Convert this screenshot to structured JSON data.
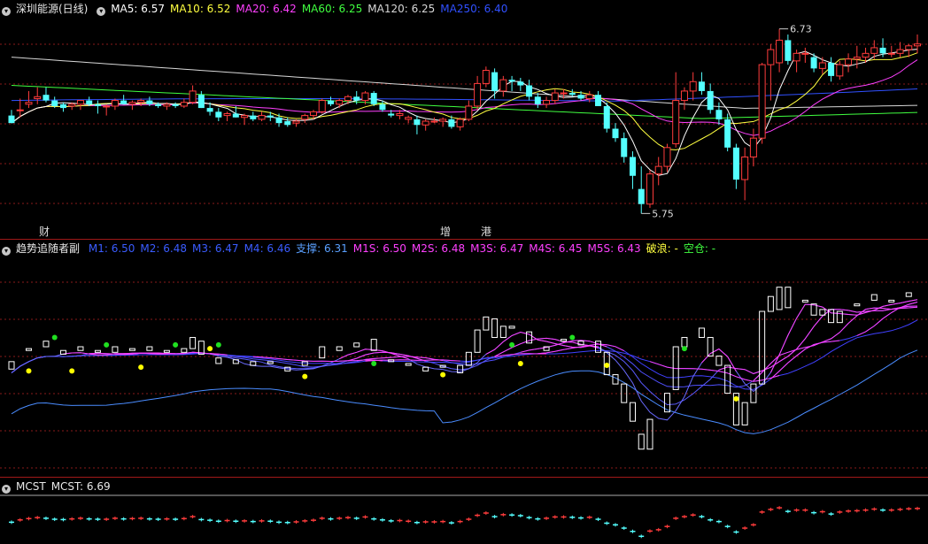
{
  "pane1": {
    "title": "深圳能源(日线)",
    "ma": [
      {
        "label": "MA5: 6.57",
        "color": "#ffffff"
      },
      {
        "label": "MA10: 6.52",
        "color": "#ffff40"
      },
      {
        "label": "MA20: 6.42",
        "color": "#ff40ff"
      },
      {
        "label": "MA60: 6.25",
        "color": "#40ff40"
      },
      {
        "label": "MA120: 6.25",
        "color": "#d8d8d8"
      },
      {
        "label": "MA250: 6.40",
        "color": "#3050ff"
      }
    ],
    "high_label": "6.73",
    "low_label": "5.75",
    "markers": [
      {
        "text": "财",
        "color": "#6aa8ff"
      },
      {
        "text": "增",
        "color": "#ff5050"
      },
      {
        "text": "港",
        "color": "#40e040"
      }
    ]
  },
  "pane2": {
    "title": "趋势追随者副",
    "fields": [
      {
        "label": "M1: 6.50",
        "color": "#3a5cff"
      },
      {
        "label": "M2: 6.48",
        "color": "#3a5cff"
      },
      {
        "label": "M3: 6.47",
        "color": "#3a5cff"
      },
      {
        "label": "M4: 6.46",
        "color": "#3a5cff"
      },
      {
        "label": "支撑: 6.31",
        "color": "#5aa0ff"
      },
      {
        "label": "M1S: 6.50",
        "color": "#ff40ff"
      },
      {
        "label": "M2S: 6.48",
        "color": "#ff40ff"
      },
      {
        "label": "M3S: 6.47",
        "color": "#ff40ff"
      },
      {
        "label": "M4S: 6.45",
        "color": "#ff40ff"
      },
      {
        "label": "M5S: 6.43",
        "color": "#ff40ff"
      },
      {
        "label": "破浪: -",
        "color": "#ffff40"
      },
      {
        "label": "空仓: -",
        "color": "#40ff40"
      }
    ]
  },
  "pane3": {
    "title": "MCST",
    "value_label": "MCST: 6.69"
  },
  "colors": {
    "up": "#ff3c3c",
    "down": "#54ffff",
    "grid": "#8a1a1a"
  },
  "chart_data": {
    "type": "candlestick",
    "candles": [
      [
        6.27,
        6.3,
        6.23,
        6.23
      ],
      [
        6.3,
        6.36,
        6.26,
        6.3
      ],
      [
        6.33,
        6.4,
        6.31,
        6.34
      ],
      [
        6.36,
        6.42,
        6.33,
        6.37
      ],
      [
        6.38,
        6.42,
        6.34,
        6.35
      ],
      [
        6.35,
        6.37,
        6.31,
        6.32
      ],
      [
        6.33,
        6.34,
        6.29,
        6.31
      ],
      [
        6.32,
        6.34,
        6.3,
        6.33
      ],
      [
        6.33,
        6.35,
        6.3,
        6.35
      ],
      [
        6.35,
        6.37,
        6.32,
        6.33
      ],
      [
        6.33,
        6.35,
        6.28,
        6.32
      ],
      [
        6.32,
        6.33,
        6.27,
        6.32
      ],
      [
        6.32,
        6.36,
        6.3,
        6.35
      ],
      [
        6.35,
        6.38,
        6.33,
        6.33
      ],
      [
        6.33,
        6.35,
        6.3,
        6.34
      ],
      [
        6.34,
        6.36,
        6.32,
        6.35
      ],
      [
        6.35,
        6.37,
        6.32,
        6.33
      ],
      [
        6.33,
        6.34,
        6.31,
        6.32
      ],
      [
        6.32,
        6.34,
        6.3,
        6.33
      ],
      [
        6.33,
        6.34,
        6.31,
        6.32
      ],
      [
        6.32,
        6.36,
        6.31,
        6.34
      ],
      [
        6.34,
        6.43,
        6.33,
        6.4
      ],
      [
        6.38,
        6.4,
        6.31,
        6.31
      ],
      [
        6.31,
        6.34,
        6.27,
        6.29
      ],
      [
        6.29,
        6.31,
        6.24,
        6.26
      ],
      [
        6.27,
        6.29,
        6.24,
        6.28
      ],
      [
        6.28,
        6.32,
        6.26,
        6.26
      ],
      [
        6.26,
        6.28,
        6.22,
        6.27
      ],
      [
        6.27,
        6.29,
        6.24,
        6.25
      ],
      [
        6.25,
        6.29,
        6.24,
        6.27
      ],
      [
        6.27,
        6.29,
        6.24,
        6.26
      ],
      [
        6.26,
        6.28,
        6.21,
        6.23
      ],
      [
        6.24,
        6.26,
        6.21,
        6.22
      ],
      [
        6.23,
        6.25,
        6.21,
        6.24
      ],
      [
        6.25,
        6.28,
        6.23,
        6.27
      ],
      [
        6.27,
        6.3,
        6.25,
        6.29
      ],
      [
        6.29,
        6.36,
        6.28,
        6.35
      ],
      [
        6.35,
        6.37,
        6.32,
        6.33
      ],
      [
        6.33,
        6.36,
        6.31,
        6.35
      ],
      [
        6.35,
        6.38,
        6.33,
        6.37
      ],
      [
        6.37,
        6.4,
        6.33,
        6.35
      ],
      [
        6.35,
        6.4,
        6.33,
        6.39
      ],
      [
        6.39,
        6.4,
        6.32,
        6.33
      ],
      [
        6.33,
        6.35,
        6.29,
        6.3
      ],
      [
        6.28,
        6.3,
        6.26,
        6.27
      ],
      [
        6.27,
        6.3,
        6.25,
        6.28
      ],
      [
        6.25,
        6.27,
        6.23,
        6.26
      ],
      [
        6.25,
        6.27,
        6.17,
        6.22
      ],
      [
        6.22,
        6.25,
        6.19,
        6.24
      ],
      [
        6.24,
        6.26,
        6.23,
        6.24
      ],
      [
        6.24,
        6.26,
        6.21,
        6.25
      ],
      [
        6.25,
        6.27,
        6.2,
        6.21
      ],
      [
        6.21,
        6.26,
        6.19,
        6.25
      ],
      [
        6.25,
        6.35,
        6.24,
        6.32
      ],
      [
        6.32,
        6.48,
        6.3,
        6.44
      ],
      [
        6.44,
        6.53,
        6.42,
        6.51
      ],
      [
        6.5,
        6.52,
        6.36,
        6.4
      ],
      [
        6.4,
        6.48,
        6.37,
        6.46
      ],
      [
        6.46,
        6.48,
        6.4,
        6.45
      ],
      [
        6.45,
        6.47,
        6.4,
        6.43
      ],
      [
        6.43,
        6.46,
        6.35,
        6.37
      ],
      [
        6.37,
        6.39,
        6.31,
        6.33
      ],
      [
        6.33,
        6.37,
        6.31,
        6.35
      ],
      [
        6.35,
        6.41,
        6.33,
        6.39
      ],
      [
        6.39,
        6.41,
        6.36,
        6.39
      ],
      [
        6.39,
        6.41,
        6.37,
        6.38
      ],
      [
        6.38,
        6.4,
        6.35,
        6.36
      ],
      [
        6.36,
        6.4,
        6.34,
        6.38
      ],
      [
        6.38,
        6.4,
        6.32,
        6.32
      ],
      [
        6.32,
        6.34,
        6.18,
        6.2
      ],
      [
        6.2,
        6.23,
        6.13,
        6.15
      ],
      [
        6.15,
        6.18,
        6.02,
        6.05
      ],
      [
        6.05,
        6.08,
        5.88,
        5.95
      ],
      [
        5.88,
        6.0,
        5.75,
        5.8
      ],
      [
        5.8,
        5.98,
        5.78,
        5.96
      ],
      [
        5.96,
        6.05,
        5.9,
        6.0
      ],
      [
        6.0,
        6.12,
        5.97,
        6.1
      ],
      [
        6.12,
        6.5,
        6.1,
        6.35
      ],
      [
        6.35,
        6.42,
        6.3,
        6.4
      ],
      [
        6.4,
        6.5,
        6.35,
        6.45
      ],
      [
        6.45,
        6.5,
        6.38,
        6.4
      ],
      [
        6.4,
        6.44,
        6.28,
        6.3
      ],
      [
        6.3,
        6.34,
        6.22,
        6.25
      ],
      [
        6.25,
        6.28,
        6.08,
        6.1
      ],
      [
        6.1,
        6.12,
        5.88,
        5.93
      ],
      [
        5.93,
        6.1,
        5.82,
        6.05
      ],
      [
        6.05,
        6.2,
        6.0,
        6.15
      ],
      [
        6.15,
        6.55,
        6.12,
        6.54
      ],
      [
        6.54,
        6.65,
        6.35,
        6.62
      ],
      [
        6.55,
        6.73,
        6.5,
        6.67
      ],
      [
        6.67,
        6.7,
        6.54,
        6.56
      ],
      [
        6.56,
        6.62,
        6.5,
        6.6
      ],
      [
        6.6,
        6.63,
        6.55,
        6.6
      ],
      [
        6.58,
        6.6,
        6.5,
        6.52
      ],
      [
        6.52,
        6.58,
        6.49,
        6.55
      ],
      [
        6.55,
        6.58,
        6.45,
        6.48
      ],
      [
        6.48,
        6.56,
        6.46,
        6.54
      ],
      [
        6.54,
        6.6,
        6.5,
        6.57
      ],
      [
        6.57,
        6.64,
        6.52,
        6.58
      ],
      [
        6.58,
        6.63,
        6.55,
        6.6
      ],
      [
        6.6,
        6.67,
        6.57,
        6.63
      ],
      [
        6.63,
        6.68,
        6.58,
        6.6
      ],
      [
        6.6,
        6.64,
        6.58,
        6.6
      ],
      [
        6.6,
        6.66,
        6.58,
        6.62
      ],
      [
        6.62,
        6.65,
        6.58,
        6.64
      ],
      [
        6.64,
        6.7,
        6.6,
        6.65
      ]
    ],
    "ylim": [
      5.7,
      6.78
    ]
  }
}
